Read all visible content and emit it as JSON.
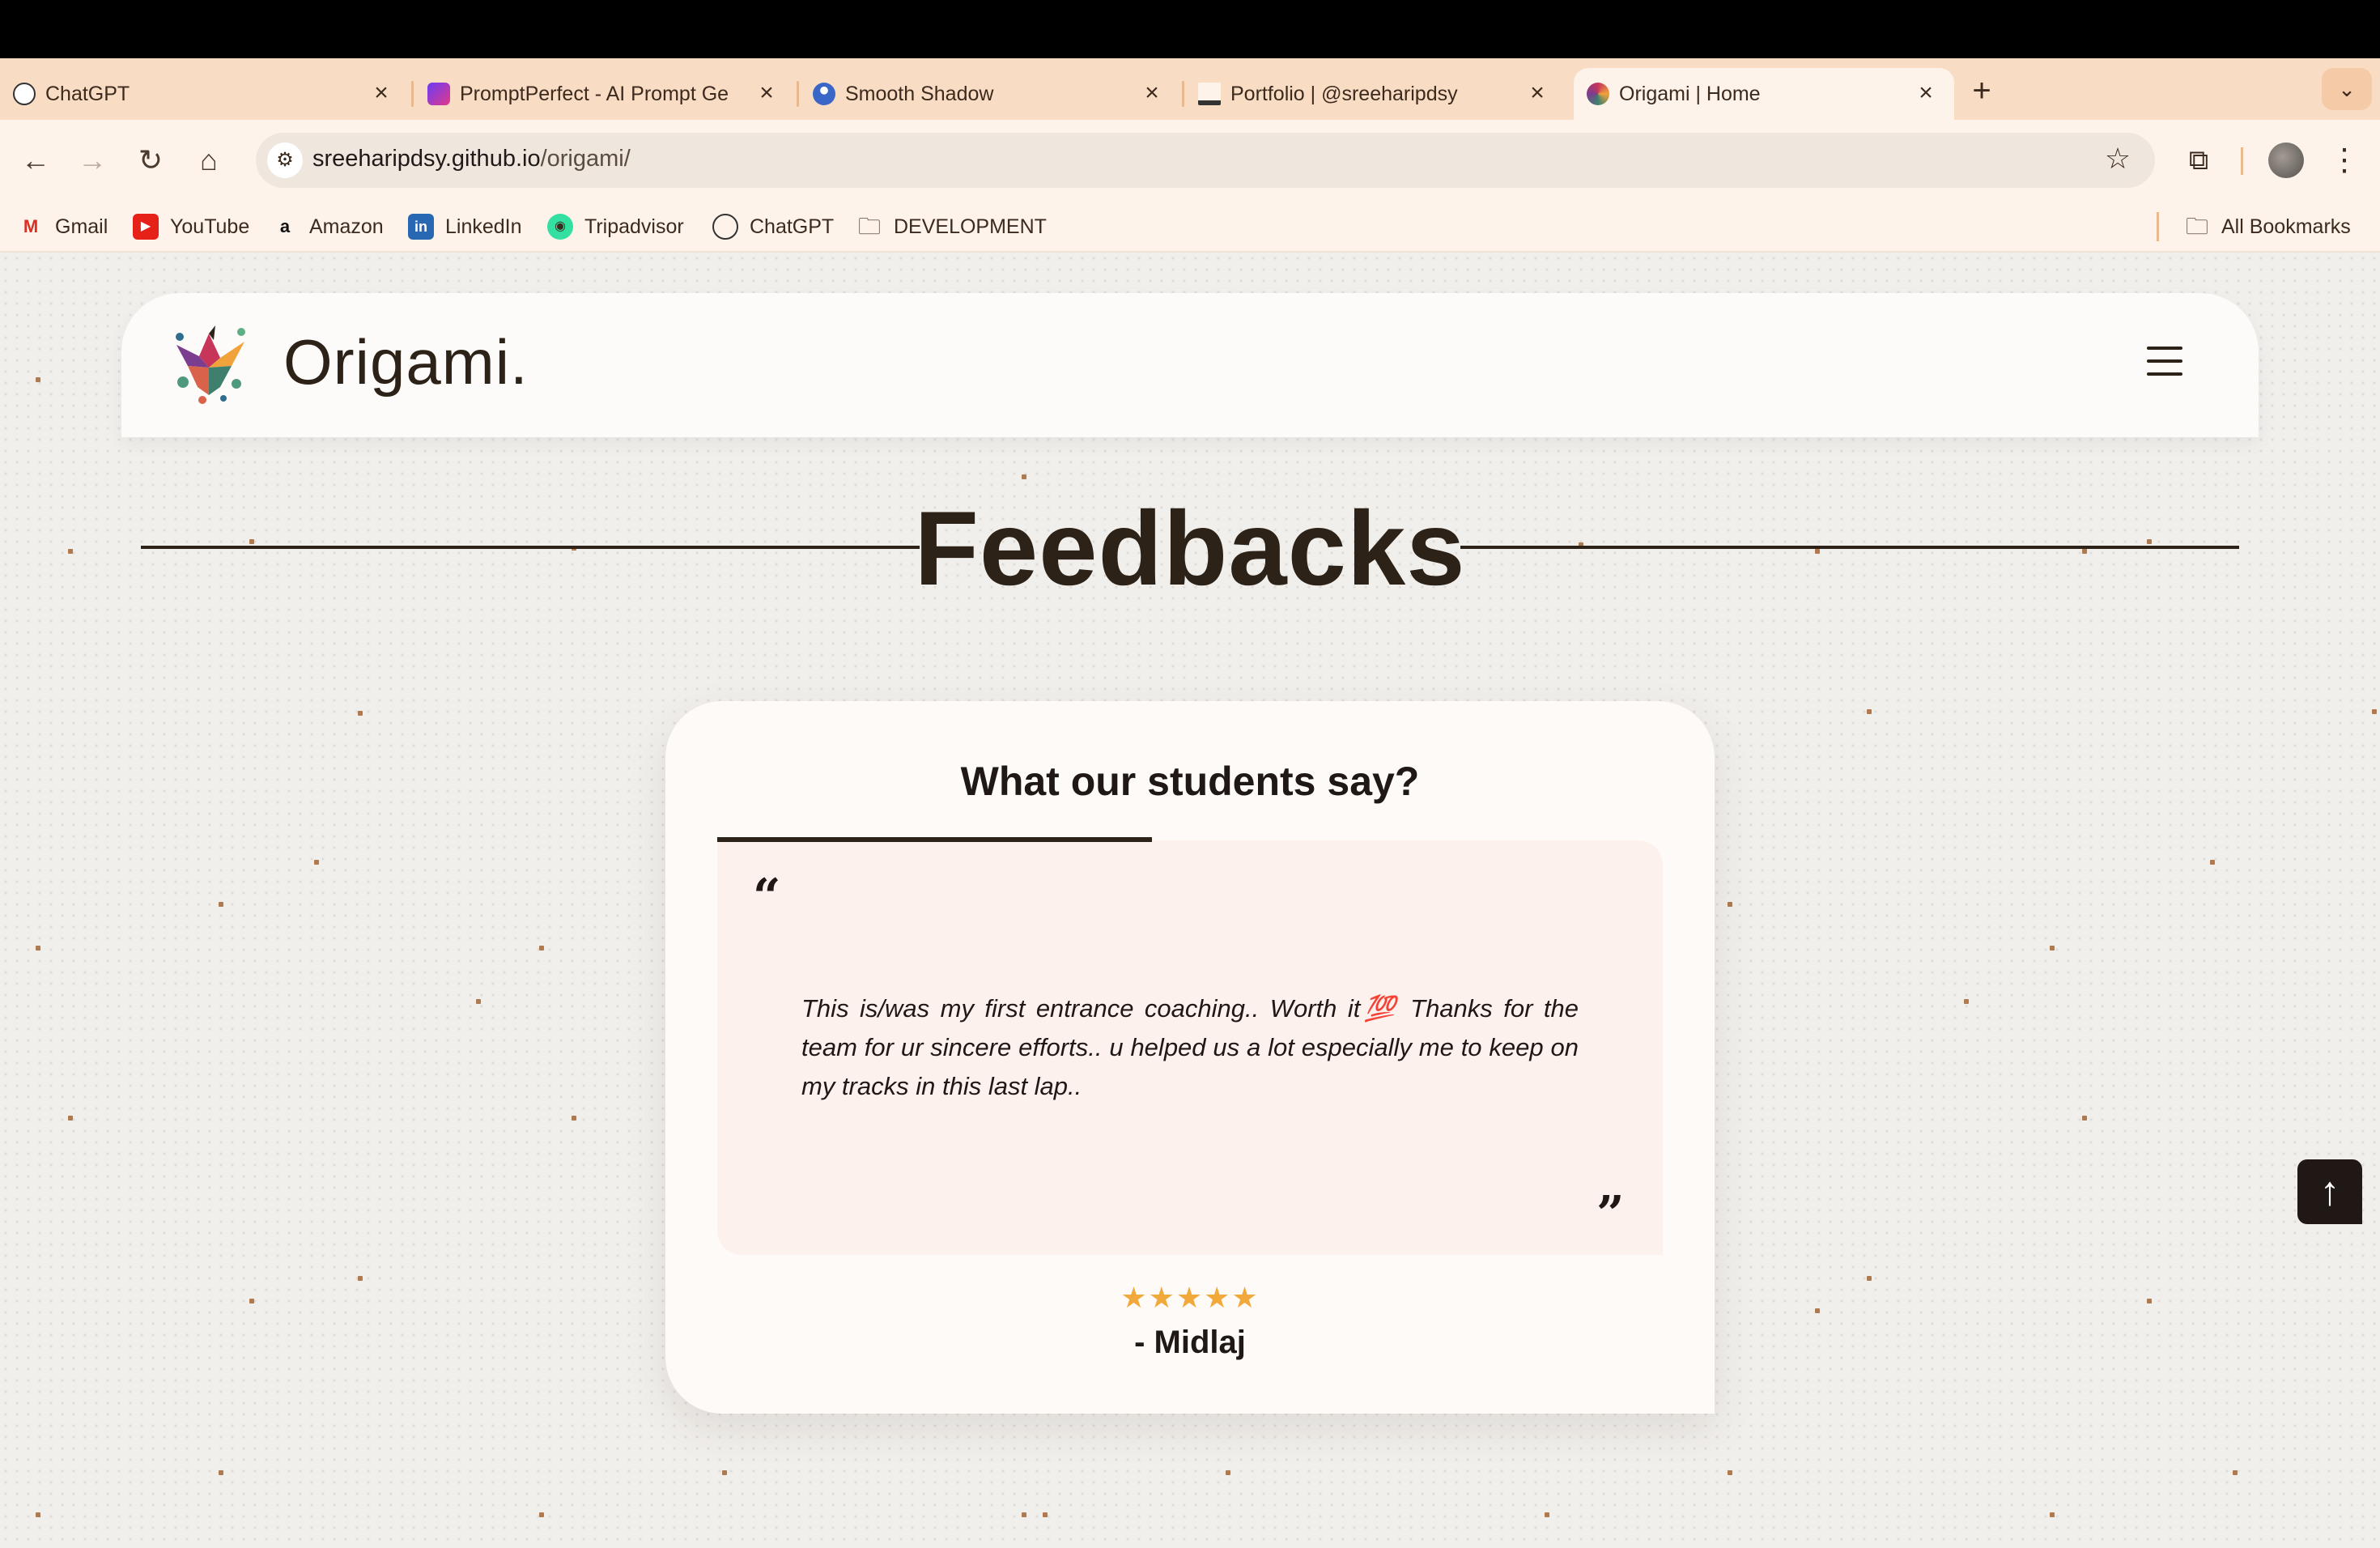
{
  "browser": {
    "tabs": [
      {
        "title": "ChatGPT",
        "favicon": "chatgpt-icon",
        "active": false
      },
      {
        "title": "PromptPerfect - AI Prompt Ge",
        "favicon": "promptperfect-icon",
        "active": false
      },
      {
        "title": "Smooth Shadow",
        "favicon": "smooth-shadow-icon",
        "active": false
      },
      {
        "title": "Portfolio | @sreeharipdsy",
        "favicon": "portfolio-icon",
        "active": false
      },
      {
        "title": "Origami | Home",
        "favicon": "origami-bird-icon",
        "active": true
      }
    ],
    "url_host": "sreeharipdsy.github.io",
    "url_path": "/origami/",
    "bookmarks": [
      {
        "label": "Gmail",
        "icon": "gmail-icon"
      },
      {
        "label": "YouTube",
        "icon": "youtube-icon"
      },
      {
        "label": "Amazon",
        "icon": "amazon-icon"
      },
      {
        "label": "LinkedIn",
        "icon": "linkedin-icon"
      },
      {
        "label": "Tripadvisor",
        "icon": "tripadvisor-icon"
      },
      {
        "label": "ChatGPT",
        "icon": "chatgpt-icon"
      },
      {
        "label": "DEVELOPMENT",
        "icon": "folder-icon"
      }
    ],
    "all_bookmarks_label": "All Bookmarks"
  },
  "site": {
    "brand": "Origami.",
    "section_title": "Feedbacks",
    "card": {
      "heading": "What our students say?",
      "progress": 0.46,
      "quote": "This is/was my first entrance coaching.. Worth it💯 Thanks for the team for ur sincere efforts.. u helped us a lot especially me to keep on my tracks in this last lap..",
      "rating": 5,
      "stars": "★★★★★",
      "author": "- Midlaj"
    }
  },
  "colors": {
    "tabstrip": "#f9dcc4",
    "toolbar": "#fdf3ea",
    "page_bg": "#f1efec",
    "ink": "#2d2218",
    "quote_box": "#fcf1ec",
    "star": "#f2a93b"
  }
}
